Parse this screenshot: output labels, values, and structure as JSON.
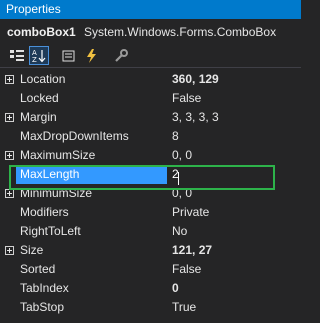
{
  "window": {
    "title": "Properties"
  },
  "object_selector": {
    "name": "comboBox1",
    "type": "System.Windows.Forms.ComboBox"
  },
  "toolbar": {
    "buttons": [
      {
        "icon": "categorized-icon",
        "active": false
      },
      {
        "icon": "alphabetical-icon",
        "active": true
      },
      {
        "icon": "properties-icon",
        "active": false
      },
      {
        "icon": "events-icon",
        "active": false
      },
      {
        "icon": "property-pages-icon",
        "active": false
      }
    ]
  },
  "properties": [
    {
      "name": "Location",
      "value": "360, 129",
      "bold": true,
      "expandable": true
    },
    {
      "name": "Locked",
      "value": "False",
      "bold": false,
      "expandable": false
    },
    {
      "name": "Margin",
      "value": "3, 3, 3, 3",
      "bold": false,
      "expandable": true
    },
    {
      "name": "MaxDropDownItems",
      "value": "8",
      "bold": false,
      "expandable": false
    },
    {
      "name": "MaximumSize",
      "value": "0, 0",
      "bold": false,
      "expandable": true
    },
    {
      "name": "MaxLength",
      "value": "2",
      "bold": false,
      "expandable": false,
      "selected": true
    },
    {
      "name": "MinimumSize",
      "value": "0, 0",
      "bold": false,
      "expandable": true
    },
    {
      "name": "Modifiers",
      "value": "Private",
      "bold": false,
      "expandable": false
    },
    {
      "name": "RightToLeft",
      "value": "No",
      "bold": false,
      "expandable": false
    },
    {
      "name": "Size",
      "value": "121, 27",
      "bold": true,
      "expandable": true
    },
    {
      "name": "Sorted",
      "value": "False",
      "bold": false,
      "expandable": false
    },
    {
      "name": "TabIndex",
      "value": "0",
      "bold": true,
      "expandable": false
    },
    {
      "name": "TabStop",
      "value": "True",
      "bold": false,
      "expandable": false
    }
  ],
  "colors": {
    "background": "#252526",
    "title_bar": "#007acc",
    "selection": "#3399ff",
    "highlight_box": "#2db34a"
  }
}
